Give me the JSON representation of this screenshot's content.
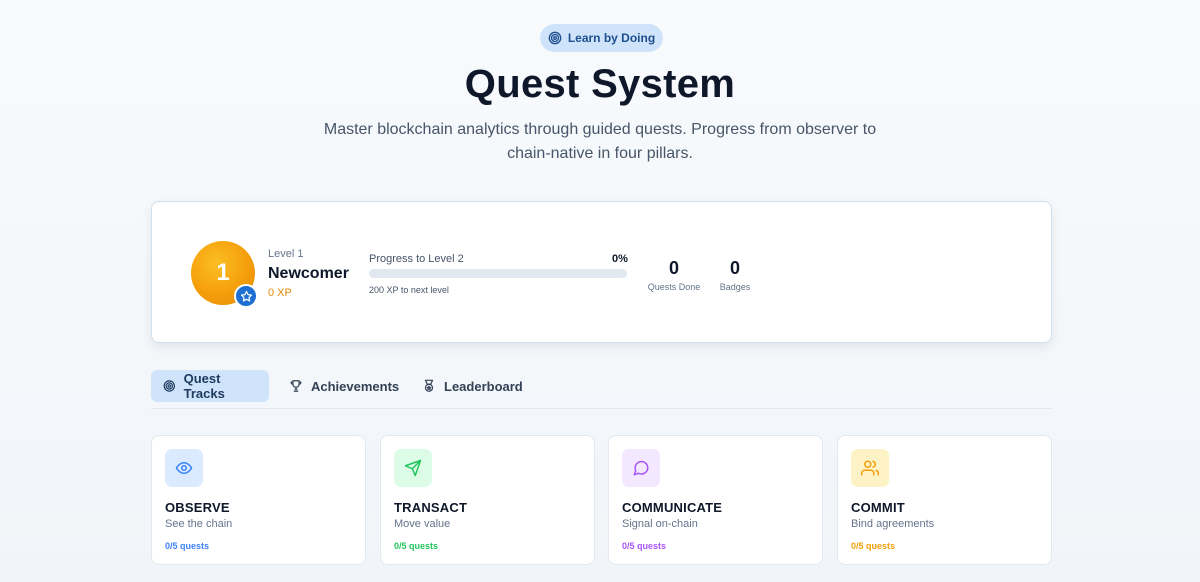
{
  "hero": {
    "pill_label": "Learn by Doing",
    "title": "Quest System",
    "subtitle": "Master blockchain analytics through guided quests. Progress from observer to chain-native in four pillars."
  },
  "profile": {
    "avatar_level": "1",
    "level_label": "Level 1",
    "level_name": "Newcomer",
    "xp": "0 XP",
    "progress_label": "Progress to Level 2",
    "progress_percent": "0%",
    "progress_fraction": 0,
    "next_level_text": "200 XP to next level",
    "quests_done_value": "0",
    "quests_done_label": "Quests Done",
    "badges_value": "0",
    "badges_label": "Badges"
  },
  "tabs": [
    {
      "label": "Quest Tracks",
      "icon": "target-icon",
      "active": true
    },
    {
      "label": "Achievements",
      "icon": "trophy-icon",
      "active": false
    },
    {
      "label": "Leaderboard",
      "icon": "medal-icon",
      "active": false
    }
  ],
  "tracks": [
    {
      "title": "OBSERVE",
      "subtitle": "See the chain",
      "count": "0/5 quests",
      "icon": "eye-icon",
      "accent": "#3b82f6",
      "bg": "#dbeafe"
    },
    {
      "title": "TRANSACT",
      "subtitle": "Move value",
      "count": "0/5 quests",
      "icon": "send-icon",
      "accent": "#22c55e",
      "bg": "#dcfce7"
    },
    {
      "title": "COMMUNICATE",
      "subtitle": "Signal on-chain",
      "count": "0/5 quests",
      "icon": "message-icon",
      "accent": "#a855f7",
      "bg": "#f3e8ff"
    },
    {
      "title": "COMMIT",
      "subtitle": "Bind agreements",
      "count": "0/5 quests",
      "icon": "users-icon",
      "accent": "#f59e0b",
      "bg": "#fef3c7"
    }
  ],
  "colors": {
    "primary": "#1d6fd1",
    "xp_orange": "#e58a06",
    "tab_active_bg": "#cfe3fb"
  }
}
